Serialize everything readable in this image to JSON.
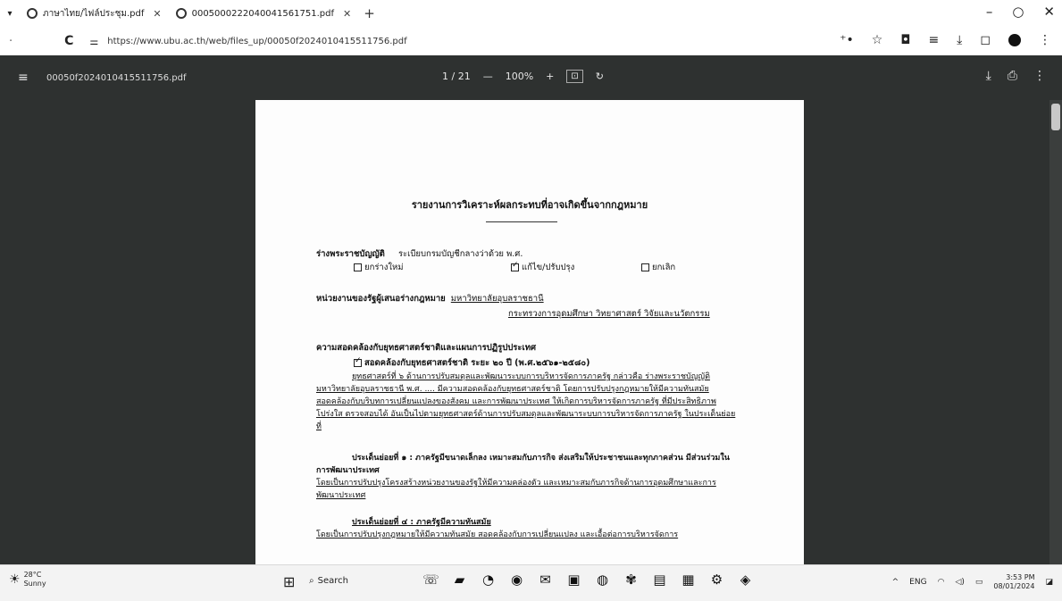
{
  "browser": {
    "tabs": [
      {
        "title": "ภาษาไทย/ไฟล์ประชุม.pdf",
        "favicon": "globe-icon"
      },
      {
        "title": "0005000222040041561751.pdf",
        "favicon": "globe-icon"
      }
    ],
    "new_tab_label": "+",
    "url": "https://www.ubu.ac.th/web/files_up/00050f2024010415511756.pdf"
  },
  "pdf": {
    "filename": "00050f2024010415511756.pdf",
    "page_current": "1",
    "page_total": "/ 21",
    "zoom": "100%",
    "zoom_minus": "—",
    "zoom_plus": "+"
  },
  "document": {
    "title": "รายงานการวิเคราะห์ผลกระทบที่อาจเกิดขึ้นจากกฎหมาย",
    "draft_label": "ร่างพระราชบัญญัติ",
    "draft_name": "ระเบียบกรมบัญชีกลางว่าด้วย พ.ศ.",
    "options": [
      {
        "label": "ยกร่างใหม่",
        "checked": false
      },
      {
        "label": "แก้ไข/ปรับปรุง",
        "checked": true
      },
      {
        "label": "ยกเลิก",
        "checked": false
      }
    ],
    "agency_label": "หน่วยงานของรัฐผู้เสนอร่างกฎหมาย",
    "agency_line1": "มหาวิทยาลัยอุบลราชธานี",
    "agency_line2": "กระทรวงการอุดมศึกษา วิทยาศาสตร์ วิจัยและนวัตกรรม",
    "consistency_heading": "ความสอดคล้องกับยุทธศาสตร์ชาติและแผนการปฏิรูปประเทศ",
    "strategy_check": "สอดคล้องกับยุทธศาสตร์ชาติ ระยะ ๒๐ ปี (พ.ศ.๒๕๖๑-๒๕๘๐)",
    "strategy_para": "ยุทธศาสตร์ที่ ๖ ด้านการปรับสมดุลและพัฒนาระบบการบริหารจัดการภาครัฐ กล่าวคือ ร่างพระราชบัญญัติมหาวิทยาลัยอุบลราชธานี พ.ศ. .... มีความสอดคล้องกับยุทธศาสตร์ชาติ โดยการปรับปรุงกฎหมายให้มีความทันสมัย สอดคล้องกับบริบทการเปลี่ยนแปลงของสังคม และการพัฒนาประเทศ ให้เกิดการบริหารจัดการภาครัฐ ที่มีประสิทธิภาพ โปร่งใส ตรวจสอบได้ อันเป็นไปตามยุทธศาสตร์ด้านการปรับสมดุลและพัฒนาระบบการบริหารจัดการภาครัฐ ในประเด็นย่อยที่",
    "issue1_heading": "ประเด็นย่อยที่ ๑ : ภาครัฐมีขนาดเล็กลง เหมาะสมกับภารกิจ ส่งเสริมให้ประชาชนและทุกภาคส่วน มีส่วนร่วมในการพัฒนาประเทศ",
    "issue1_para": "โดยเป็นการปรับปรุงโครงสร้างหน่วยงานของรัฐให้มีความคล่องตัว และเหมาะสมกับภารกิจด้านการอุดมศึกษาและการพัฒนาประเทศ",
    "issue2_heading": "ประเด็นย่อยที่ ๔ : ภาครัฐมีความทันสมัย",
    "issue2_para": "โดยเป็นการปรับปรุงกฎหมายให้มีความทันสมัย สอดคล้องกับการเปลี่ยนแปลง และเอื้อต่อการบริหารจัดการ"
  },
  "taskbar": {
    "temp": "28°C",
    "condition": "Sunny",
    "search_label": "Search",
    "lang": "ENG",
    "time": "3:53 PM",
    "date": "08/01/2024",
    "apps": [
      "chat-icon",
      "folder-icon",
      "edge-icon",
      "chrome-icon",
      "mail-icon",
      "store-icon",
      "teams-icon",
      "photos-icon",
      "word-icon",
      "excel-icon",
      "settings-icon",
      "browser-icon"
    ]
  }
}
